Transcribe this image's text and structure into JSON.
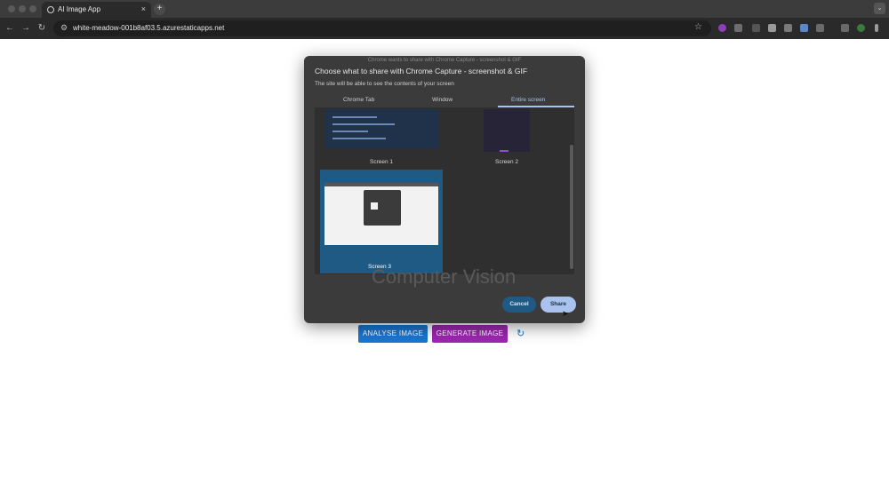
{
  "browser": {
    "tab_title": "AI Image App",
    "tab_close": "×",
    "new_tab": "+",
    "tab_menu": "⌄",
    "url": "white-meadow-001b8af03.5.azurestaticapps.net",
    "nav_back": "←",
    "nav_forward": "→",
    "nav_reload": "↻",
    "star": "☆"
  },
  "page": {
    "analyse_button": "ANALYSE IMAGE",
    "generate_button": "GENERATE IMAGE",
    "refresh_icon": "↻"
  },
  "dialog": {
    "top_caption": "Chrome wants to share with Chrome Capture - screenshot & GIF",
    "title": "Choose what to share with Chrome Capture - screenshot & GIF",
    "subtitle": "The site will be able to see the contents of your screen",
    "tabs": [
      "Chrome Tab",
      "Window",
      "Entire screen"
    ],
    "active_tab": "Entire screen",
    "screens": [
      "Screen 1",
      "Screen 2",
      "Screen 3"
    ],
    "selected_screen": "Screen 3",
    "background_text": "Computer Vision",
    "cancel_button": "Cancel",
    "share_button": "Share"
  },
  "colors": {
    "analyse": "#1976d2",
    "generate": "#9c27b0",
    "share": "#a9c3ee",
    "cancel": "#1f5a85"
  }
}
